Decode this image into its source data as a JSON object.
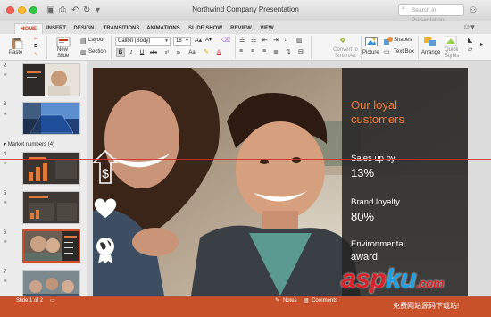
{
  "window": {
    "title": "Northwind Company Presentation",
    "search_placeholder": "Search in Presentation"
  },
  "tabs": [
    {
      "label": "HOME"
    },
    {
      "label": "INSERT"
    },
    {
      "label": "DESIGN"
    },
    {
      "label": "TRANSITIONS"
    },
    {
      "label": "ANIMATIONS"
    },
    {
      "label": "SLIDE SHOW"
    },
    {
      "label": "REVIEW"
    },
    {
      "label": "VIEW"
    }
  ],
  "ribbon": {
    "paste": "Paste",
    "new_slide": "New\nSlide",
    "layout": "Layout",
    "section": "Section",
    "font_name": "Calibri (Body)",
    "font_size": "18",
    "convert_to_smartart": "Convert to\nSmartArt",
    "picture": "Picture",
    "shapes": "Shapes",
    "text_box": "Text Box",
    "arrange": "Arrange",
    "quick_styles": "Quick\nStyles"
  },
  "panel": {
    "slides": [
      {
        "num": "2"
      },
      {
        "num": "3"
      },
      {
        "num": "4"
      },
      {
        "num": "5"
      },
      {
        "num": "6"
      },
      {
        "num": "7"
      }
    ],
    "section_label": "Market numbers (4)"
  },
  "slide": {
    "title": "Our loyal\ncustomers",
    "stats": [
      {
        "label": "Sales up by",
        "value": "13%",
        "icon": "dollar-arrow-icon"
      },
      {
        "label": "Brand loyalty",
        "value": "80%",
        "icon": "heart-icon"
      },
      {
        "label": "Environmental",
        "value": "award",
        "icon": "award-globe-icon"
      }
    ]
  },
  "status": {
    "slide_counter": "Slide 1 of 2",
    "notes": "Notes",
    "comments": "Comments"
  },
  "watermark": {
    "brand": "asp",
    "brand_k": "ku",
    "brand_tail": ".com",
    "sub": "免费网站源码下载站!"
  },
  "colors": {
    "accent": "#c43e1c",
    "status_bar": "#c8512a",
    "slide_title": "#ee7a3c"
  }
}
